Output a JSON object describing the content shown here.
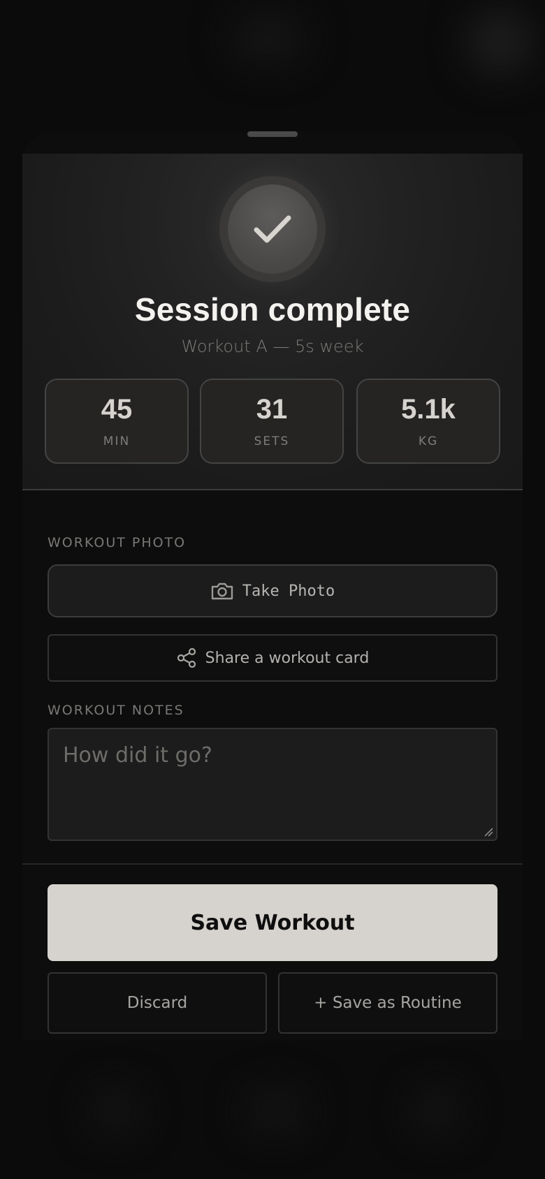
{
  "header": {
    "title": "Session complete",
    "subtitle": "Workout A — 5s week",
    "status_icon": "checkmark-icon"
  },
  "stats": [
    {
      "value": "45",
      "label": "MIN"
    },
    {
      "value": "31",
      "label": "SETS"
    },
    {
      "value": "5.1k",
      "label": "KG"
    }
  ],
  "photo": {
    "section_label": "WORKOUT PHOTO",
    "take_photo_label": "Take Photo",
    "take_photo_icon": "camera-icon",
    "share_label": "Share a workout card",
    "share_icon": "share-icon"
  },
  "notes": {
    "section_label": "WORKOUT NOTES",
    "placeholder": "How did it go?",
    "value": ""
  },
  "actions": {
    "save_label": "Save Workout",
    "discard_label": "Discard",
    "save_routine_label": "+ Save as Routine"
  },
  "colors": {
    "background": "#0b0b0b",
    "panel": "#1c1c1c",
    "primary_button": "#d6d2cd",
    "text_primary": "#f4f2ef",
    "text_muted": "#7d7b78"
  }
}
